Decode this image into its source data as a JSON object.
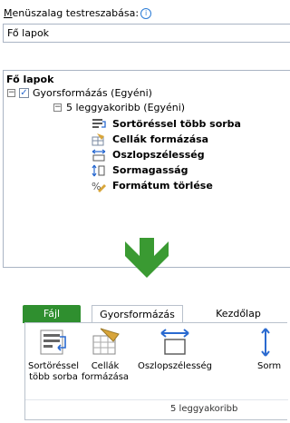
{
  "header": {
    "label": "Menüszalag testreszabása:",
    "label_access_key": "M",
    "info_icon": "info-icon",
    "dropdown_value": "Fő lapok"
  },
  "tree": {
    "title": "Fő lapok",
    "tab_node": {
      "label": "Gyorsformázás (Egyéni)",
      "checked": true,
      "expanded": true
    },
    "group_node": {
      "label": "5 leggyakoribb (Egyéni)",
      "expanded": true
    },
    "commands": [
      {
        "label": "Sortöréssel több sorba",
        "icon": "wrap-text-icon"
      },
      {
        "label": "Cellák formázása",
        "icon": "format-cells-icon"
      },
      {
        "label": "Oszlopszélesség",
        "icon": "column-width-icon"
      },
      {
        "label": "Sormagasság",
        "icon": "row-height-icon"
      },
      {
        "label": "Formátum törlése",
        "icon": "clear-format-icon"
      }
    ]
  },
  "arrow": {
    "icon": "down-arrow-icon",
    "color": "#3a9a32"
  },
  "ribbon": {
    "tabs": [
      {
        "label": "Fájl",
        "color": "#2f8f2f"
      },
      {
        "label": "Gyorsformázás",
        "active": true
      },
      {
        "label": "Kezdőlap"
      }
    ],
    "buttons": [
      {
        "line1": "Sortöréssel",
        "line2": "több sorba",
        "icon": "wrap-text-icon"
      },
      {
        "line1": "Cellák",
        "line2": "formázása",
        "icon": "format-cells-icon"
      },
      {
        "line1": "Oszlopszélesség",
        "line2": "",
        "icon": "column-width-icon"
      },
      {
        "line1": "Sorm",
        "line2": "",
        "icon": "row-height-icon"
      }
    ],
    "group_label": "5 leggyakoribb"
  }
}
